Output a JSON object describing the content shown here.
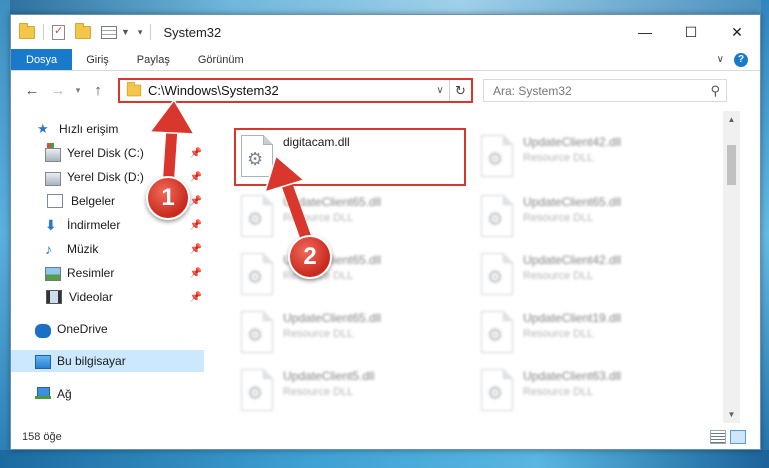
{
  "window": {
    "title": "System32"
  },
  "ribbon": {
    "tabs": [
      "Dosya",
      "Giriş",
      "Paylaş",
      "Görünüm"
    ]
  },
  "navigation": {
    "address": "C:\\Windows\\System32",
    "search_placeholder": "Ara: System32"
  },
  "sidebar": {
    "items": [
      {
        "label": "Hızlı erişim",
        "icon": "star-icon"
      },
      {
        "label": "Yerel Disk (C:)",
        "icon": "drive-icon",
        "pinned": true
      },
      {
        "label": "Yerel Disk (D:)",
        "icon": "drive-icon",
        "pinned": true
      },
      {
        "label": "Belgeler",
        "icon": "documents-icon",
        "pinned": true
      },
      {
        "label": "İndirmeler",
        "icon": "downloads-icon",
        "pinned": true
      },
      {
        "label": "Müzik",
        "icon": "music-icon",
        "pinned": true
      },
      {
        "label": "Resimler",
        "icon": "pictures-icon",
        "pinned": true
      },
      {
        "label": "Videolar",
        "icon": "videos-icon",
        "pinned": true
      },
      {
        "label": "OneDrive",
        "icon": "onedrive-icon"
      },
      {
        "label": "Bu bilgisayar",
        "icon": "computer-icon",
        "selected": true
      },
      {
        "label": "Ağ",
        "icon": "network-icon"
      }
    ]
  },
  "files": [
    {
      "name": "digitacam.dll",
      "type": "",
      "highlighted": true
    },
    {
      "name": "UpdateClient42.dll",
      "type": "Resource DLL"
    },
    {
      "name": "UpdateClient65.dll",
      "type": "Resource DLL"
    },
    {
      "name": "UpdateClient65.dll",
      "type": "Resource DLL"
    },
    {
      "name": "UpdateClient65.dll",
      "type": "Resource DLL"
    },
    {
      "name": "UpdateClient42.dll",
      "type": "Resource DLL"
    },
    {
      "name": "UpdateClient65.dll",
      "type": "Resource DLL"
    },
    {
      "name": "UpdateClient19.dll",
      "type": "Resource DLL"
    },
    {
      "name": "UpdateClient5.dll",
      "type": "Resource DLL"
    },
    {
      "name": "UpdateClient63.dll",
      "type": "Resource DLL"
    }
  ],
  "status": {
    "item_count": "158 öğe"
  },
  "callouts": [
    "1",
    "2"
  ],
  "colors": {
    "accent": "#1979ca",
    "highlight_red": "#d9362e",
    "selection": "#cce8ff"
  }
}
